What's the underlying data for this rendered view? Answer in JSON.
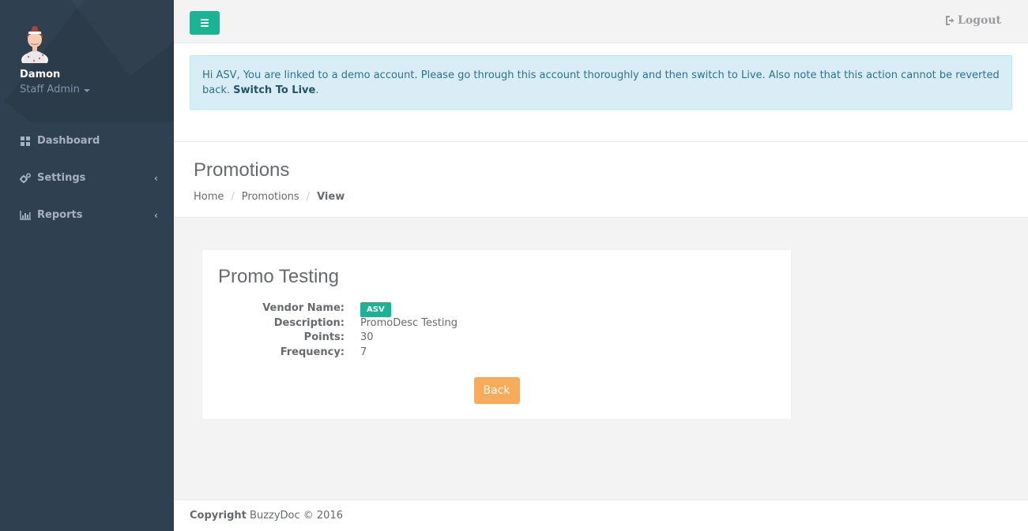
{
  "sidebar": {
    "profile": {
      "name": "Damon",
      "role": "Staff Admin"
    },
    "items": [
      {
        "label": "Dashboard",
        "icon": "dashboard-icon",
        "has_arrow": false
      },
      {
        "label": "Settings",
        "icon": "cogs-icon",
        "has_arrow": true
      },
      {
        "label": "Reports",
        "icon": "bar-chart-icon",
        "has_arrow": true
      }
    ],
    "arrow_glyph": "‹"
  },
  "topbar": {
    "logout_label": "Logout"
  },
  "alert": {
    "text": "Hi ASV, You are linked to a demo account. Please go through this account thoroughly and then switch to Live. Also note that this action cannot be reverted back. ",
    "link_label": "Switch To Live",
    "suffix": "."
  },
  "page": {
    "title": "Promotions",
    "breadcrumb": [
      "Home",
      "Promotions",
      "View"
    ],
    "separator": "/"
  },
  "promo": {
    "title": "Promo Testing",
    "fields": [
      {
        "label": "Vendor Name:",
        "value": "ASV",
        "badge": true
      },
      {
        "label": "Description:",
        "value": "PromoDesc Testing",
        "badge": false
      },
      {
        "label": "Points:",
        "value": "30",
        "badge": false
      },
      {
        "label": "Frequency:",
        "value": "7",
        "badge": false
      }
    ],
    "back_label": "Back"
  },
  "footer": {
    "strong": "Copyright",
    "text": " BuzzyDoc © 2016"
  },
  "colors": {
    "sidebar_bg": "#2f4050",
    "accent": "#1ab394",
    "warning": "#f8ac59",
    "info_bg": "#d9edf7",
    "info_text": "#31708f"
  }
}
